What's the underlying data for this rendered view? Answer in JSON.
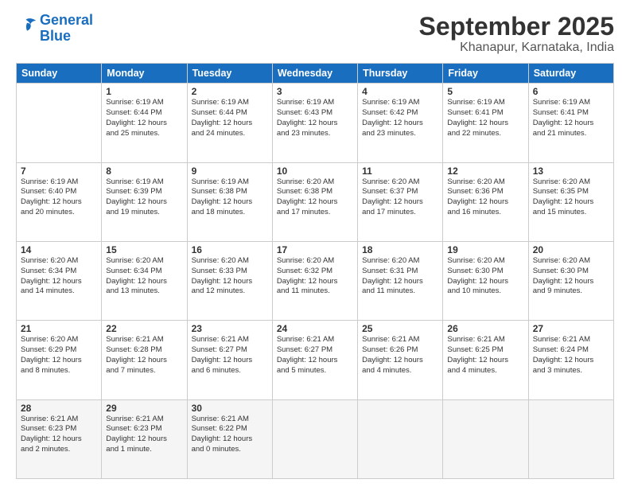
{
  "logo": {
    "line1": "General",
    "line2": "Blue"
  },
  "title": "September 2025",
  "subtitle": "Khanapur, Karnataka, India",
  "weekdays": [
    "Sunday",
    "Monday",
    "Tuesday",
    "Wednesday",
    "Thursday",
    "Friday",
    "Saturday"
  ],
  "weeks": [
    [
      {
        "day": "",
        "info": ""
      },
      {
        "day": "1",
        "info": "Sunrise: 6:19 AM\nSunset: 6:44 PM\nDaylight: 12 hours\nand 25 minutes."
      },
      {
        "day": "2",
        "info": "Sunrise: 6:19 AM\nSunset: 6:44 PM\nDaylight: 12 hours\nand 24 minutes."
      },
      {
        "day": "3",
        "info": "Sunrise: 6:19 AM\nSunset: 6:43 PM\nDaylight: 12 hours\nand 23 minutes."
      },
      {
        "day": "4",
        "info": "Sunrise: 6:19 AM\nSunset: 6:42 PM\nDaylight: 12 hours\nand 23 minutes."
      },
      {
        "day": "5",
        "info": "Sunrise: 6:19 AM\nSunset: 6:41 PM\nDaylight: 12 hours\nand 22 minutes."
      },
      {
        "day": "6",
        "info": "Sunrise: 6:19 AM\nSunset: 6:41 PM\nDaylight: 12 hours\nand 21 minutes."
      }
    ],
    [
      {
        "day": "7",
        "info": "Sunrise: 6:19 AM\nSunset: 6:40 PM\nDaylight: 12 hours\nand 20 minutes."
      },
      {
        "day": "8",
        "info": "Sunrise: 6:19 AM\nSunset: 6:39 PM\nDaylight: 12 hours\nand 19 minutes."
      },
      {
        "day": "9",
        "info": "Sunrise: 6:19 AM\nSunset: 6:38 PM\nDaylight: 12 hours\nand 18 minutes."
      },
      {
        "day": "10",
        "info": "Sunrise: 6:20 AM\nSunset: 6:38 PM\nDaylight: 12 hours\nand 17 minutes."
      },
      {
        "day": "11",
        "info": "Sunrise: 6:20 AM\nSunset: 6:37 PM\nDaylight: 12 hours\nand 17 minutes."
      },
      {
        "day": "12",
        "info": "Sunrise: 6:20 AM\nSunset: 6:36 PM\nDaylight: 12 hours\nand 16 minutes."
      },
      {
        "day": "13",
        "info": "Sunrise: 6:20 AM\nSunset: 6:35 PM\nDaylight: 12 hours\nand 15 minutes."
      }
    ],
    [
      {
        "day": "14",
        "info": "Sunrise: 6:20 AM\nSunset: 6:34 PM\nDaylight: 12 hours\nand 14 minutes."
      },
      {
        "day": "15",
        "info": "Sunrise: 6:20 AM\nSunset: 6:34 PM\nDaylight: 12 hours\nand 13 minutes."
      },
      {
        "day": "16",
        "info": "Sunrise: 6:20 AM\nSunset: 6:33 PM\nDaylight: 12 hours\nand 12 minutes."
      },
      {
        "day": "17",
        "info": "Sunrise: 6:20 AM\nSunset: 6:32 PM\nDaylight: 12 hours\nand 11 minutes."
      },
      {
        "day": "18",
        "info": "Sunrise: 6:20 AM\nSunset: 6:31 PM\nDaylight: 12 hours\nand 11 minutes."
      },
      {
        "day": "19",
        "info": "Sunrise: 6:20 AM\nSunset: 6:30 PM\nDaylight: 12 hours\nand 10 minutes."
      },
      {
        "day": "20",
        "info": "Sunrise: 6:20 AM\nSunset: 6:30 PM\nDaylight: 12 hours\nand 9 minutes."
      }
    ],
    [
      {
        "day": "21",
        "info": "Sunrise: 6:20 AM\nSunset: 6:29 PM\nDaylight: 12 hours\nand 8 minutes."
      },
      {
        "day": "22",
        "info": "Sunrise: 6:21 AM\nSunset: 6:28 PM\nDaylight: 12 hours\nand 7 minutes."
      },
      {
        "day": "23",
        "info": "Sunrise: 6:21 AM\nSunset: 6:27 PM\nDaylight: 12 hours\nand 6 minutes."
      },
      {
        "day": "24",
        "info": "Sunrise: 6:21 AM\nSunset: 6:27 PM\nDaylight: 12 hours\nand 5 minutes."
      },
      {
        "day": "25",
        "info": "Sunrise: 6:21 AM\nSunset: 6:26 PM\nDaylight: 12 hours\nand 4 minutes."
      },
      {
        "day": "26",
        "info": "Sunrise: 6:21 AM\nSunset: 6:25 PM\nDaylight: 12 hours\nand 4 minutes."
      },
      {
        "day": "27",
        "info": "Sunrise: 6:21 AM\nSunset: 6:24 PM\nDaylight: 12 hours\nand 3 minutes."
      }
    ],
    [
      {
        "day": "28",
        "info": "Sunrise: 6:21 AM\nSunset: 6:23 PM\nDaylight: 12 hours\nand 2 minutes."
      },
      {
        "day": "29",
        "info": "Sunrise: 6:21 AM\nSunset: 6:23 PM\nDaylight: 12 hours\nand 1 minute."
      },
      {
        "day": "30",
        "info": "Sunrise: 6:21 AM\nSunset: 6:22 PM\nDaylight: 12 hours\nand 0 minutes."
      },
      {
        "day": "",
        "info": ""
      },
      {
        "day": "",
        "info": ""
      },
      {
        "day": "",
        "info": ""
      },
      {
        "day": "",
        "info": ""
      }
    ]
  ]
}
